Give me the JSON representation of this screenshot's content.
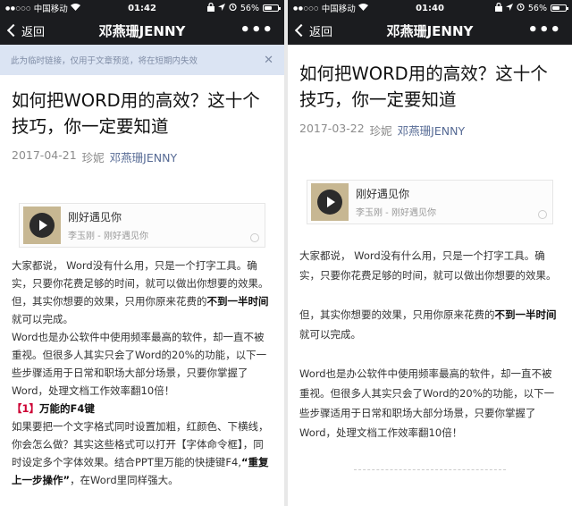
{
  "left": {
    "status": {
      "dots": "●●○○○",
      "carrier": "中国移动",
      "time": "01:42",
      "battery": "56%",
      "battery_level": 0.56
    },
    "nav": {
      "back": "返回",
      "title": "邓燕珊JENNY",
      "more": "•••"
    },
    "notice": {
      "text": "此为临时链接，仅用于文章预览，将在短期内失效",
      "close": "✕"
    },
    "article": {
      "title": "如何把WORD用的高效？这十个技巧，你一定要知道",
      "date": "2017-04-21",
      "author": "珍妮",
      "account": "邓燕珊JENNY"
    },
    "music": {
      "song": "刚好遇见你",
      "singer": "李玉刚 - 刚好遇见你"
    },
    "body": {
      "p1": "大家都说， Word没有什么用，只是一个打字工具。确实，只要你花费足够的时间，就可以做出你想要的效果。",
      "p2_a": "但，其实你想要的效果，只用你原来花费的",
      "p2_b": "不到一半时间",
      "p2_c": "就可以完成。",
      "p3": "Word也是办公软件中使用频率最高的软件，却一直不被重视。但很多人其实只会了Word的20%的功能，以下一些步骤适用于日常和职场大部分场景，只要你掌握了Word，处理文档工作效率翻10倍！",
      "sec_num": "【1】",
      "sec_title": "万能的F4键",
      "p4_a": "如果要把一个文字格式同时设置加粗，红颜色、下横线，你会怎么做？其实这些格式可以打开【字体命令框】，同时设定多个字体效果。结合PPT里万能的快捷键F4,",
      "p4_b": "“重复上一步操作”",
      "p4_c": "，在Word里同样强大。"
    }
  },
  "right": {
    "status": {
      "dots": "●●○○○",
      "carrier": "中国移动",
      "time": "01:40",
      "battery": "56%",
      "battery_level": 0.56
    },
    "nav": {
      "back": "返回",
      "title": "邓燕珊JENNY",
      "more": "•••"
    },
    "article": {
      "title": "如何把WORD用的高效？这十个技巧，你一定要知道",
      "date": "2017-03-22",
      "author": "珍妮",
      "account": "邓燕珊JENNY"
    },
    "music": {
      "song": "刚好遇见你",
      "singer": "李玉刚 - 刚好遇见你"
    },
    "body": {
      "p1": "大家都说， Word没有什么用，只是一个打字工具。确实，只要你花费足够的时间，就可以做出你想要的效果。",
      "p2_a": "但，其实你想要的效果，只用你原来花费的",
      "p2_b": "不到一半时间",
      "p2_c": "就可以完成。",
      "p3": "Word也是办公软件中使用频率最高的软件，却一直不被重视。但很多人其实只会了Word的20%的功能，以下一些步骤适用于日常和职场大部分场景，只要你掌握了Word，处理文档工作效率翻10倍！"
    }
  }
}
